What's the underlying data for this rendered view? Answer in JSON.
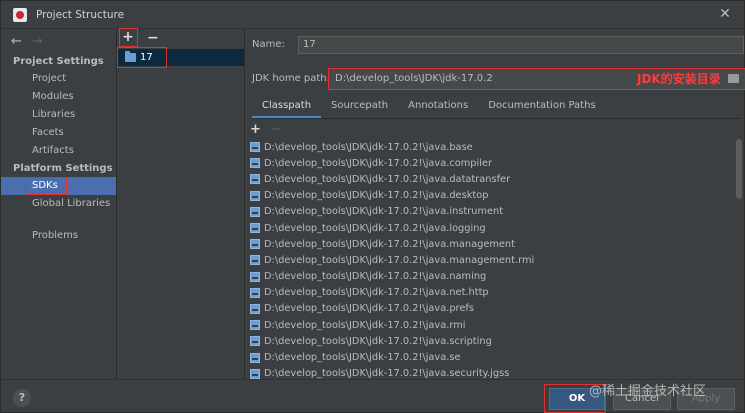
{
  "window": {
    "title": "Project Structure"
  },
  "nav": {
    "project_settings_header": "Project Settings",
    "project_settings": [
      "Project",
      "Modules",
      "Libraries",
      "Facets",
      "Artifacts"
    ],
    "platform_settings_header": "Platform Settings",
    "platform_settings": [
      "SDKs",
      "Global Libraries"
    ],
    "problems": "Problems"
  },
  "sdk_list": {
    "add_label": "+",
    "remove_label": "−",
    "items": [
      "17"
    ]
  },
  "detail": {
    "name_label": "Name:",
    "name_value": "17",
    "jdk_home_label": "JDK home path:",
    "jdk_home_value": "D:\\develop_tools\\JDK\\jdk-17.0.2",
    "jdk_annotation": "JDK的安装目录",
    "tabs": [
      "Classpath",
      "Sourcepath",
      "Annotations",
      "Documentation Paths"
    ],
    "active_tab": "Classpath",
    "list_add": "+",
    "list_remove": "−",
    "classpath_items": [
      "D:\\develop_tools\\JDK\\jdk-17.0.2!\\java.base",
      "D:\\develop_tools\\JDK\\jdk-17.0.2!\\java.compiler",
      "D:\\develop_tools\\JDK\\jdk-17.0.2!\\java.datatransfer",
      "D:\\develop_tools\\JDK\\jdk-17.0.2!\\java.desktop",
      "D:\\develop_tools\\JDK\\jdk-17.0.2!\\java.instrument",
      "D:\\develop_tools\\JDK\\jdk-17.0.2!\\java.logging",
      "D:\\develop_tools\\JDK\\jdk-17.0.2!\\java.management",
      "D:\\develop_tools\\JDK\\jdk-17.0.2!\\java.management.rmi",
      "D:\\develop_tools\\JDK\\jdk-17.0.2!\\java.naming",
      "D:\\develop_tools\\JDK\\jdk-17.0.2!\\java.net.http",
      "D:\\develop_tools\\JDK\\jdk-17.0.2!\\java.prefs",
      "D:\\develop_tools\\JDK\\jdk-17.0.2!\\java.rmi",
      "D:\\develop_tools\\JDK\\jdk-17.0.2!\\java.scripting",
      "D:\\develop_tools\\JDK\\jdk-17.0.2!\\java.se",
      "D:\\develop_tools\\JDK\\jdk-17.0.2!\\java.security.jgss"
    ]
  },
  "footer": {
    "help": "?",
    "ok": "OK",
    "cancel": "Cancel",
    "apply": "Apply",
    "watermark": "@稀土掘金技术社区"
  },
  "colors": {
    "annotation_red": "#e03030",
    "selection_blue": "#4b6eaf"
  }
}
